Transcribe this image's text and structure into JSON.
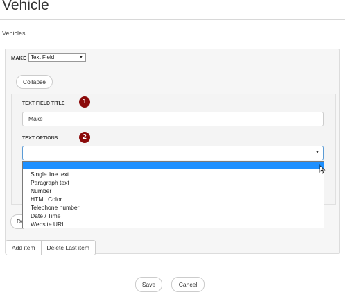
{
  "page": {
    "title": "Vehicle",
    "breadcrumb": "Vehicles"
  },
  "make_row": {
    "label": "MAKE",
    "selected_type": "Text Field"
  },
  "collapse_label": "Collapse",
  "text_field_title": {
    "label": "TEXT FIELD TITLE",
    "value": "Make",
    "badge": "1"
  },
  "text_options": {
    "label": "TEXT OPTIONS",
    "badge": "2",
    "selected_value": "",
    "options": [
      "Single line text",
      "Paragraph text",
      "Number",
      "HTML Color",
      "Telephone number",
      "Date / Time",
      "Website URL"
    ]
  },
  "hidden_button_label": "De",
  "item_buttons": {
    "add": "Add item",
    "delete_last": "Delete Last item"
  },
  "footer": {
    "save": "Save",
    "cancel": "Cancel"
  },
  "colors": {
    "badge": "#8b0a0a",
    "highlight": "#1e90ff",
    "focus_border": "#5b9bd5"
  },
  "icons": [
    "chevron-down-icon",
    "mouse-cursor-icon"
  ]
}
